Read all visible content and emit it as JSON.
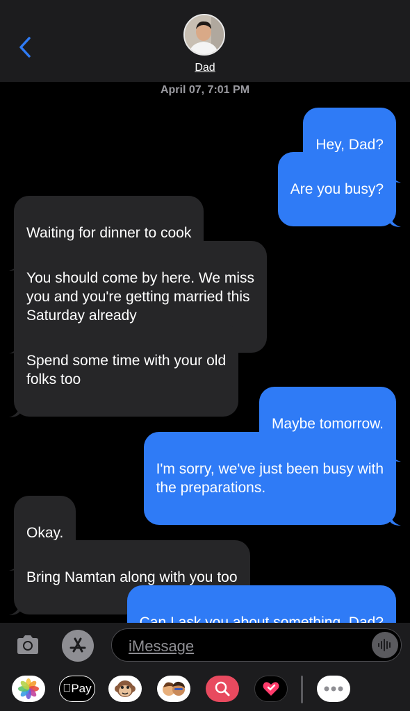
{
  "header": {
    "contact_name": "Dad"
  },
  "conversation": {
    "timestamp": "April 07, 7:01 PM",
    "messages": [
      {
        "dir": "out",
        "text": "Hey, Dad?"
      },
      {
        "dir": "out",
        "text": "Are you busy?"
      },
      {
        "dir": "in",
        "text": "Waiting for dinner to cook"
      },
      {
        "dir": "in",
        "text": "You should come by here. We miss\nyou and you're getting married this\nSaturday already"
      },
      {
        "dir": "in",
        "text": "Spend some time with your old\nfolks too"
      },
      {
        "dir": "out",
        "text": "Maybe tomorrow."
      },
      {
        "dir": "out",
        "text": "I'm sorry, we've just been busy with\nthe preparations."
      },
      {
        "dir": "in",
        "text": "Okay."
      },
      {
        "dir": "in",
        "text": "Bring Namtan along with you too"
      },
      {
        "dir": "out",
        "text": "Can I ask you about something, Dad?"
      }
    ]
  },
  "composer": {
    "placeholder": "iMessage"
  },
  "app_drawer": {
    "apple_pay_label": "Pay",
    "items": [
      "photos-icon",
      "apple-pay-icon",
      "monkey-memoji-icon",
      "memoji-stickers-icon",
      "search-images-icon",
      "digital-touch-icon",
      "more-icon"
    ]
  },
  "colors": {
    "outgoing": "#2f7bf6",
    "incoming": "#262628",
    "accent": "#2f7bf6"
  }
}
